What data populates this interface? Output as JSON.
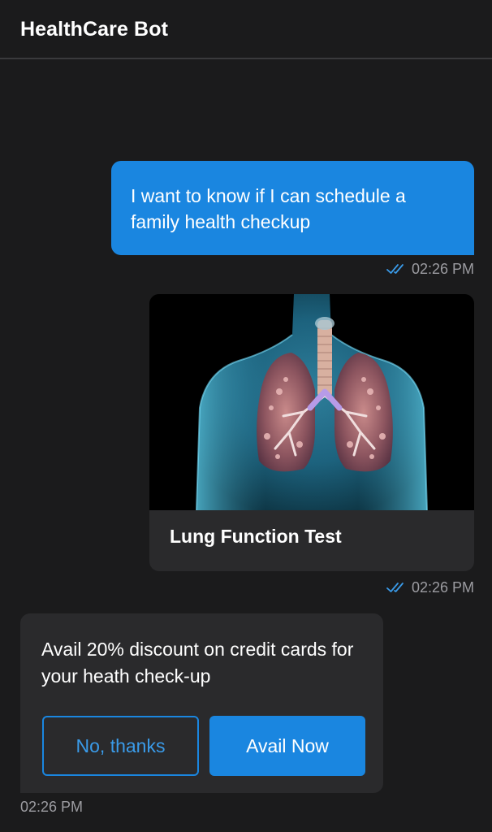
{
  "header": {
    "title": "HealthCare Bot"
  },
  "messages": {
    "user": {
      "text": "I want to know if I can schedule a family health checkup",
      "time": "02:26 PM"
    },
    "card": {
      "title": "Lung Function Test",
      "time": "02:26 PM"
    },
    "bot": {
      "text": "Avail 20% discount on credit cards for your heath check-up",
      "decline_label": "No, thanks",
      "accept_label": "Avail Now",
      "time": "02:26 PM"
    }
  },
  "colors": {
    "background": "#1b1b1c",
    "accent": "#1a86e0",
    "bubble": "#2a2a2c",
    "muted": "#9c9ca1"
  },
  "icons": {
    "read_receipt": "double-check-icon",
    "card_image": "lungs-illustration"
  }
}
